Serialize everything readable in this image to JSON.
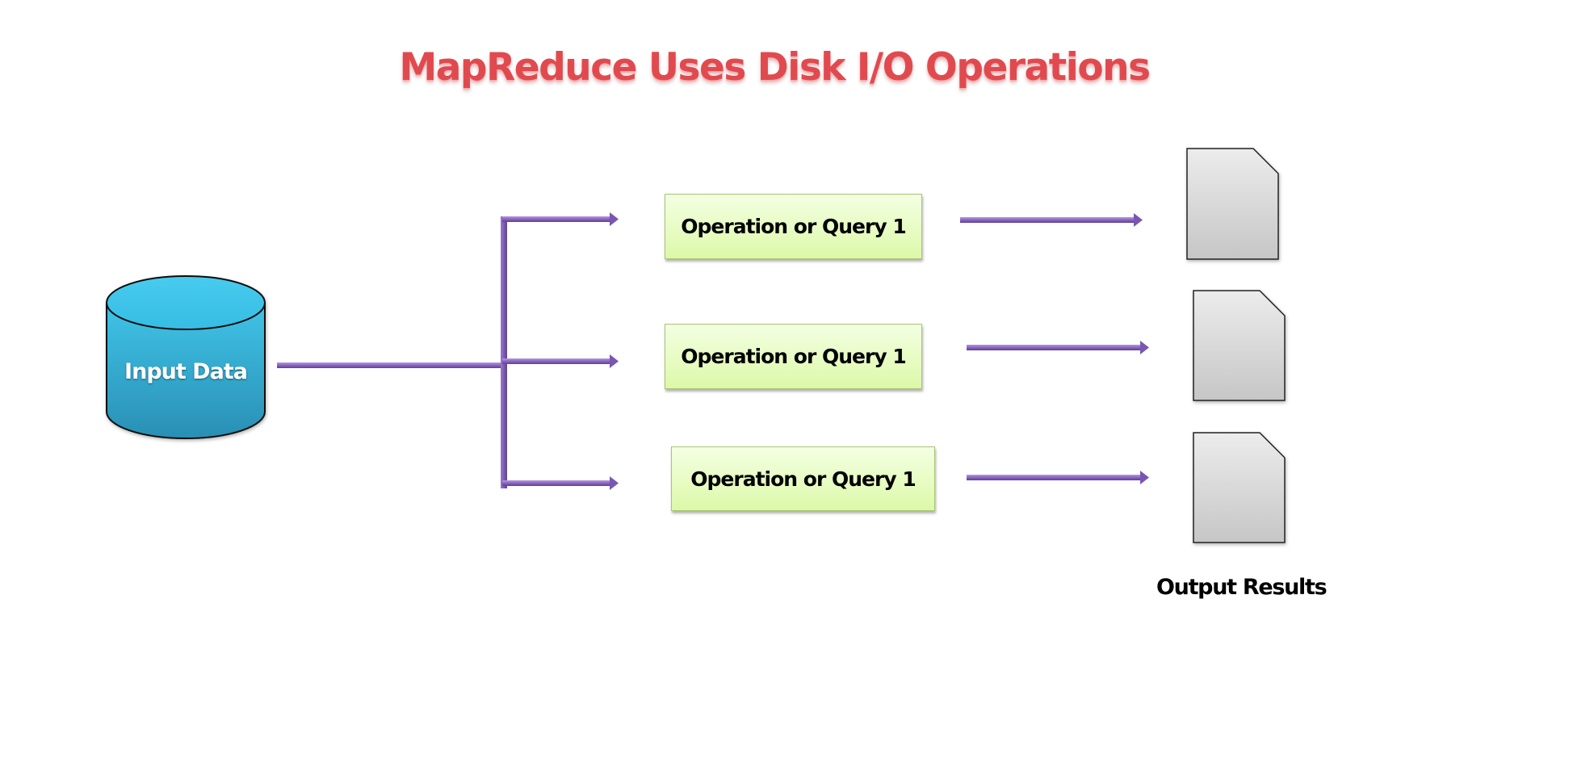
{
  "title": "MapReduce Uses Disk I/O Operations",
  "input": {
    "label": "Input Data",
    "icon": "database-cylinder-icon"
  },
  "operations": [
    {
      "label": "Operation or Query 1"
    },
    {
      "label": "Operation or Query 1"
    },
    {
      "label": "Operation or Query 1"
    }
  ],
  "outputs": {
    "label": "Output Results",
    "icon": "document-icon",
    "count": 3
  },
  "colors": {
    "title": "#e04a4f",
    "connector": "#8a64c0",
    "database": "#2fa8cf",
    "operation_box": "#e6fcc0",
    "document": "#d9d9d9"
  }
}
